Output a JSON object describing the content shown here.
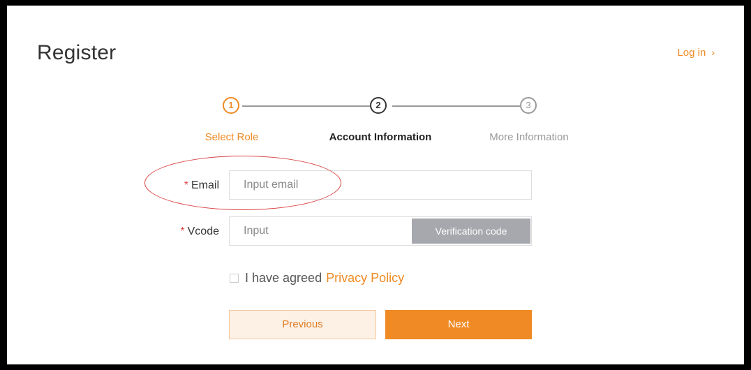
{
  "header": {
    "title": "Register",
    "login_label": "Log in",
    "login_chevron": "›"
  },
  "steps": [
    {
      "number": "1",
      "label": "Select Role",
      "state": "done"
    },
    {
      "number": "2",
      "label": "Account Information",
      "state": "active"
    },
    {
      "number": "3",
      "label": "More Information",
      "state": "future"
    }
  ],
  "form": {
    "email": {
      "required_mark": "*",
      "label": "Email",
      "value": "",
      "placeholder": "Input email"
    },
    "vcode": {
      "required_mark": "*",
      "label": "Vcode",
      "value": "",
      "placeholder": "Input",
      "button_label": "Verification code"
    },
    "agree": {
      "text": "I have agreed",
      "link": "Privacy Policy",
      "checked": false
    }
  },
  "buttons": {
    "previous": "Previous",
    "next": "Next"
  },
  "colors": {
    "accent": "#f08a24",
    "required": "#e14b4b",
    "annotation": "#d94040",
    "disabled_button": "#a6a8ad"
  }
}
